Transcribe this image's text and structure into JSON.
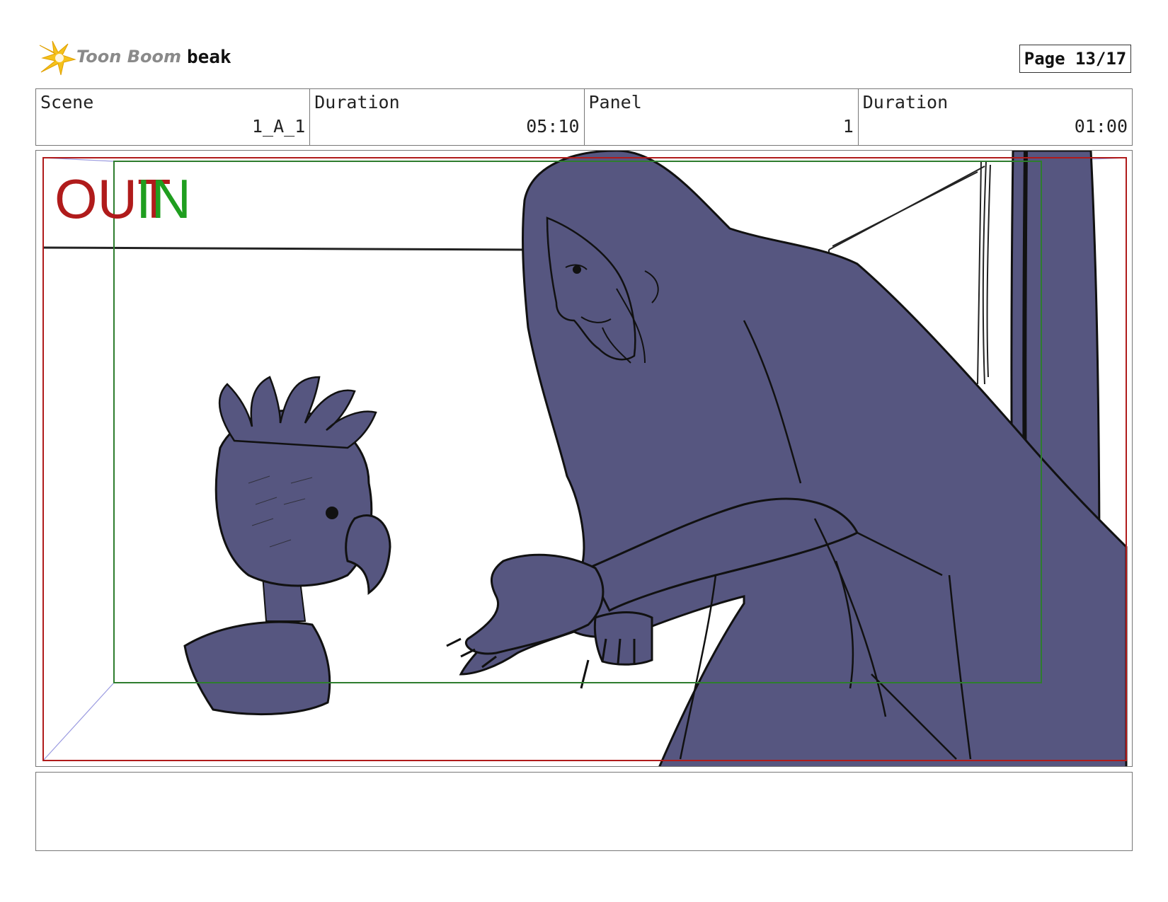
{
  "header": {
    "logo_text": "Toon Boom",
    "project_name": "beak",
    "page_label": "Page 13/17"
  },
  "info": [
    {
      "label": "Scene",
      "value": "1_A_1"
    },
    {
      "label": "Duration",
      "value": "05:10"
    },
    {
      "label": "Panel",
      "value": "1"
    },
    {
      "label": "Duration",
      "value": "01:00"
    }
  ],
  "panel": {
    "transition_out": "OUT",
    "transition_in": "IN",
    "colors": {
      "character_fill": "#565680",
      "line": "#111111",
      "safe_frame": "#2e7d2e",
      "camera_frame": "#b01b1b",
      "perspective": "#9a9ae0"
    }
  },
  "notes": {
    "text": ""
  }
}
